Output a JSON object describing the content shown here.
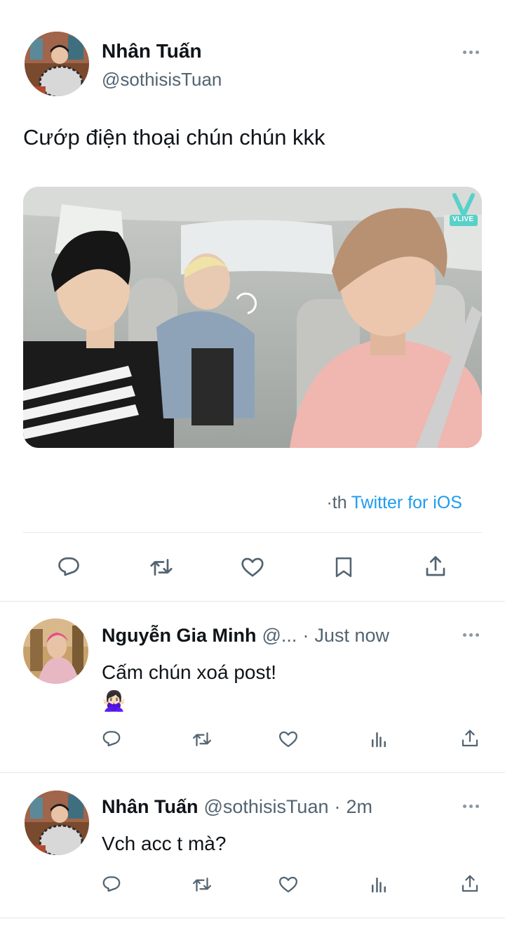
{
  "main_tweet": {
    "author_name": "Nhân Tuấn",
    "author_handle": "@sothisisTuan",
    "text": "Cướp điện thoại chún chún kkk",
    "media_badge": "VLIVE",
    "meta_partial": "·th",
    "separator": "·",
    "source": "Twitter for iOS"
  },
  "replies": [
    {
      "author_name": "Nguyễn Gia Minh",
      "author_handle": "@...",
      "time": "Just now",
      "text": "Cấm chún xoá post!",
      "emoji": "🙅🏻‍♀️"
    },
    {
      "author_name": "Nhân Tuấn",
      "author_handle": "@sothisisTuan",
      "time": "2m",
      "text": "Vch acc t mà?"
    }
  ],
  "colors": {
    "link": "#1d9bf0",
    "muted": "#536471",
    "divider": "#e1e8ed"
  }
}
